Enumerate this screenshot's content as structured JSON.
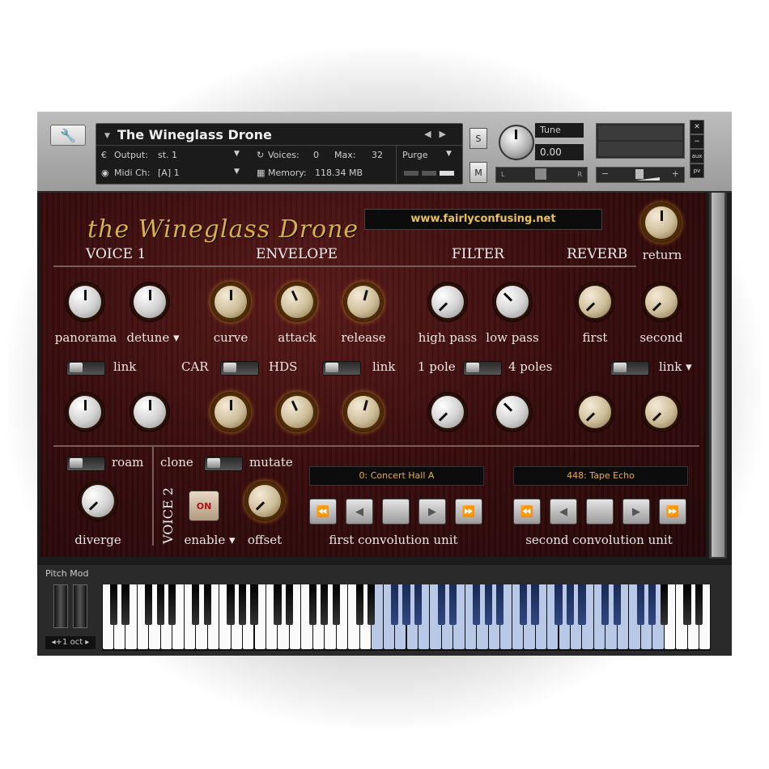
{
  "header": {
    "instrument_name": "The Wineglass Drone",
    "output_label": "Output:",
    "output_value": "st. 1",
    "midi_label": "Midi Ch:",
    "midi_value": "[A]  1",
    "voices_label": "Voices:",
    "voices_value": "0",
    "max_label": "Max:",
    "max_value": "32",
    "memory_label": "Memory:",
    "memory_value": "118.34 MB",
    "purge_label": "Purge",
    "solo_label": "S",
    "mute_label": "M",
    "tune_label": "Tune",
    "tune_value": "0.00",
    "pan_left": "L",
    "pan_right": "R",
    "aux_label": "aux",
    "pv_label": "pv"
  },
  "panel": {
    "url": "www.fairlyconfusing.net",
    "logo": "the Wineglass Drone",
    "sections": {
      "voice1": "VOICE 1",
      "envelope": "ENVELOPE",
      "filter": "FILTER",
      "reverb": "REVERB",
      "return": "return",
      "voice2": "VOICE 2"
    },
    "knob_labels": {
      "panorama": "panorama",
      "detune": "detune ▾",
      "curve": "curve",
      "attack": "attack",
      "release": "release",
      "high_pass": "high pass",
      "low_pass": "low pass",
      "first": "first",
      "second": "second",
      "diverge": "diverge",
      "offset": "offset",
      "enable": "enable ▾"
    },
    "toggles": {
      "link1": "link",
      "car": "CAR",
      "hds": "HDS",
      "link2": "link",
      "one_pole": "1 pole",
      "four_poles": "4 poles",
      "link3": "link ▾",
      "roam": "roam",
      "clone": "clone",
      "mutate": "mutate"
    },
    "on_button": "ON",
    "first_unit": {
      "display": "0: Concert Hall A",
      "label": "first convolution unit"
    },
    "second_unit": {
      "display": "448: Tape Echo",
      "label": "second convolution unit"
    }
  },
  "keyboard": {
    "pitch_mod_label": "Pitch Mod",
    "octave_label": "◂+1 oct ▸"
  },
  "colors": {
    "accent": "#e6b040",
    "panel": "#3a0d0e",
    "key_range": "#b9c8e6"
  }
}
